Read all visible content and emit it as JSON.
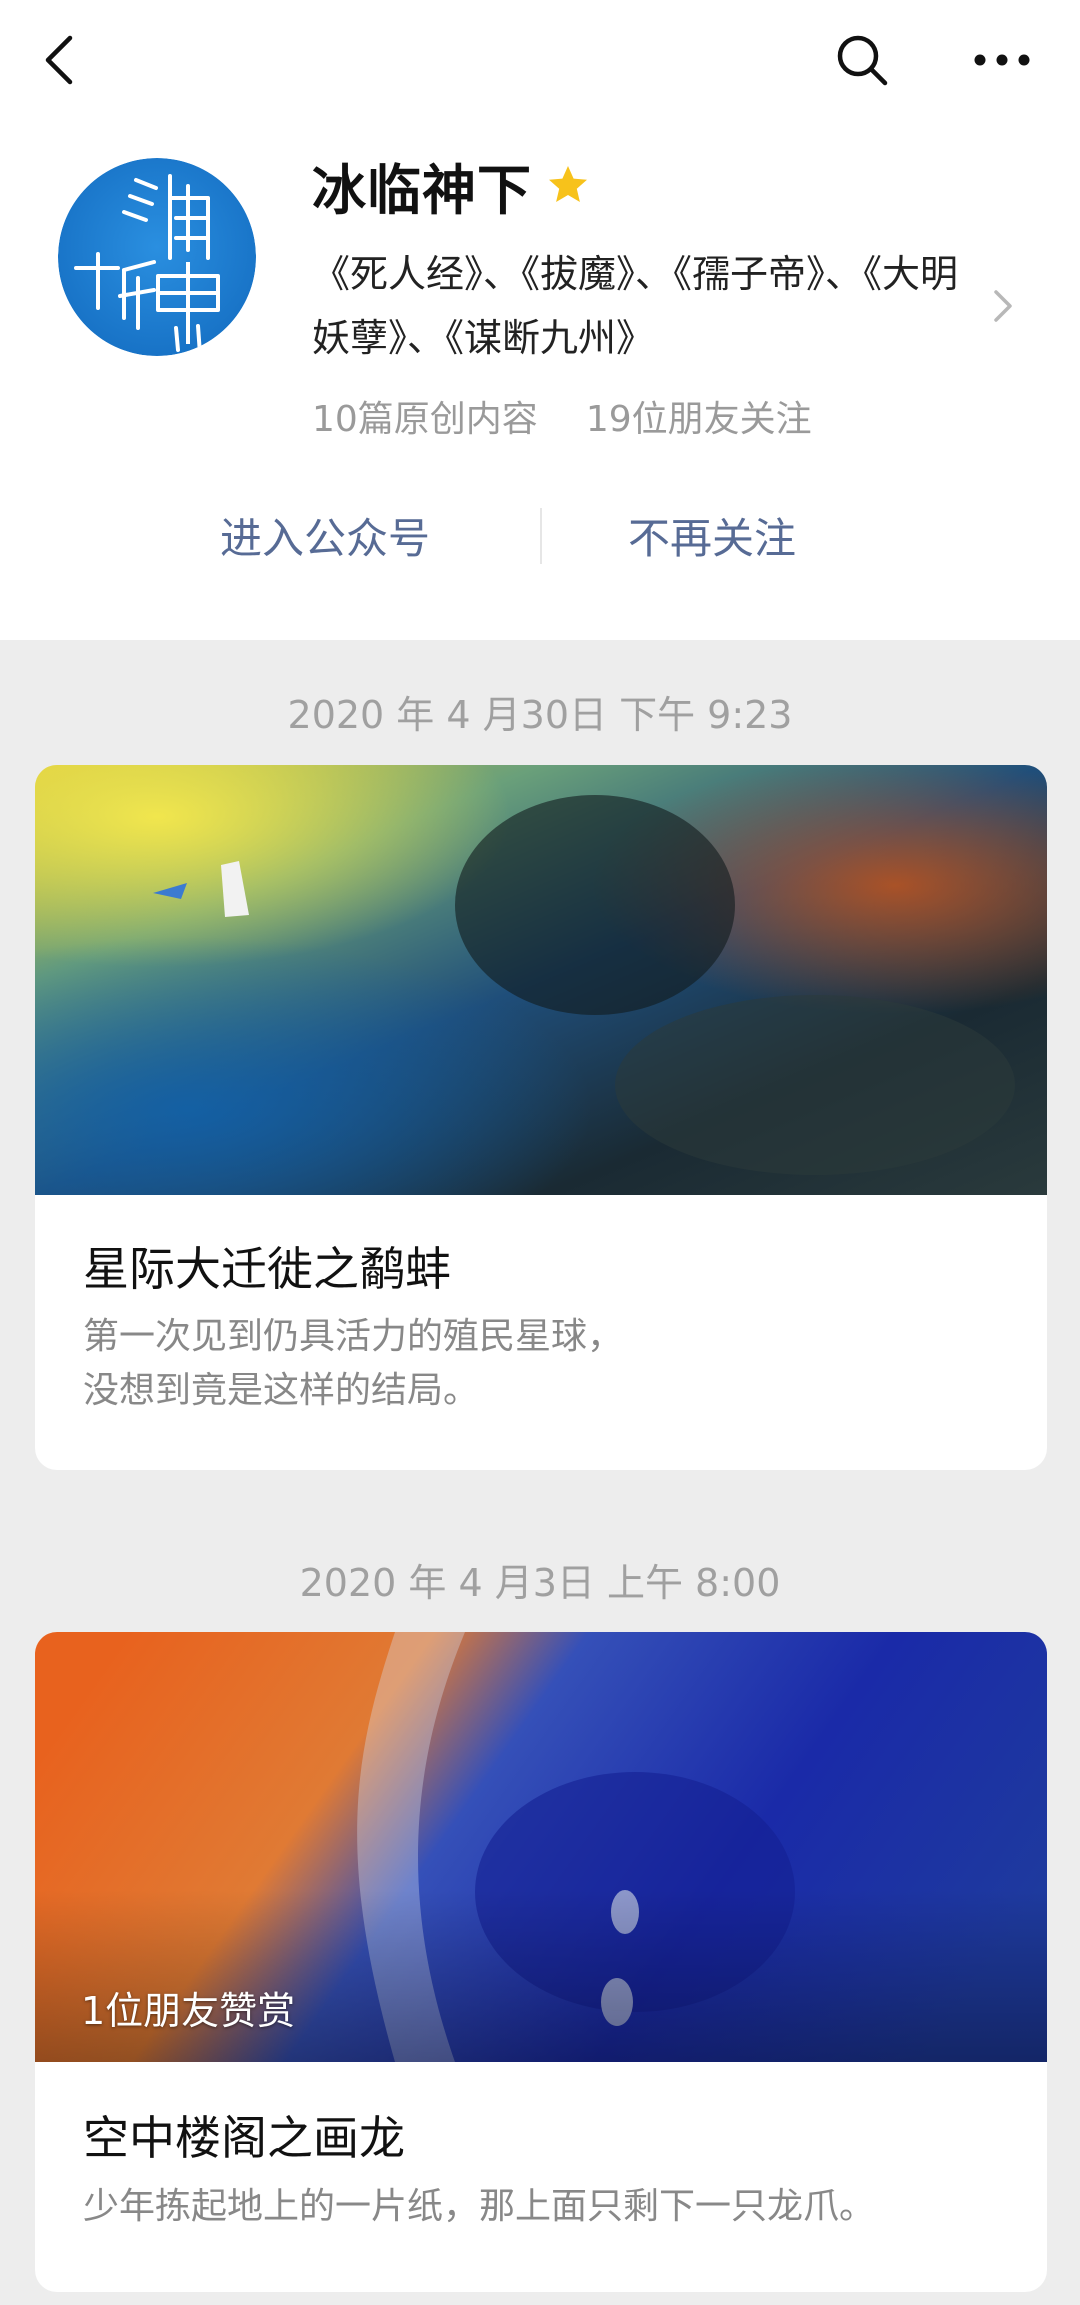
{
  "top_bar": {
    "back_icon": "chevron-left-icon",
    "search_icon": "search-icon",
    "more_icon": "more-dots-icon"
  },
  "profile": {
    "name": "冰临神下",
    "verified_icon": "star-icon",
    "star_color": "#f7c21b",
    "avatar_color": "#1a7fd4",
    "description": "《死人经》、《拔魔》、《孺子帝》、《大明妖孽》、《谋断九州》",
    "stats": {
      "original": "10篇原创内容",
      "followers": "19位朋友关注"
    }
  },
  "actions": {
    "enter": "进入公众号",
    "unfollow": "不再关注",
    "accent_color": "#576b95"
  },
  "feed": [
    {
      "date": "2020 年 4 月30日 下午 9:23",
      "title": "星际大迁徙之鹬蚌",
      "summary_lines": [
        "第一次见到仍具活力的殖民星球，",
        "没想到竟是这样的结局。"
      ],
      "badge": ""
    },
    {
      "date": "2020 年 4 月3日 上午 8:00",
      "title": "空中楼阁之画龙",
      "summary_lines": [
        "少年拣起地上的一片纸，那上面只剩下一只龙爪。"
      ],
      "badge": "1位朋友赞赏"
    }
  ]
}
